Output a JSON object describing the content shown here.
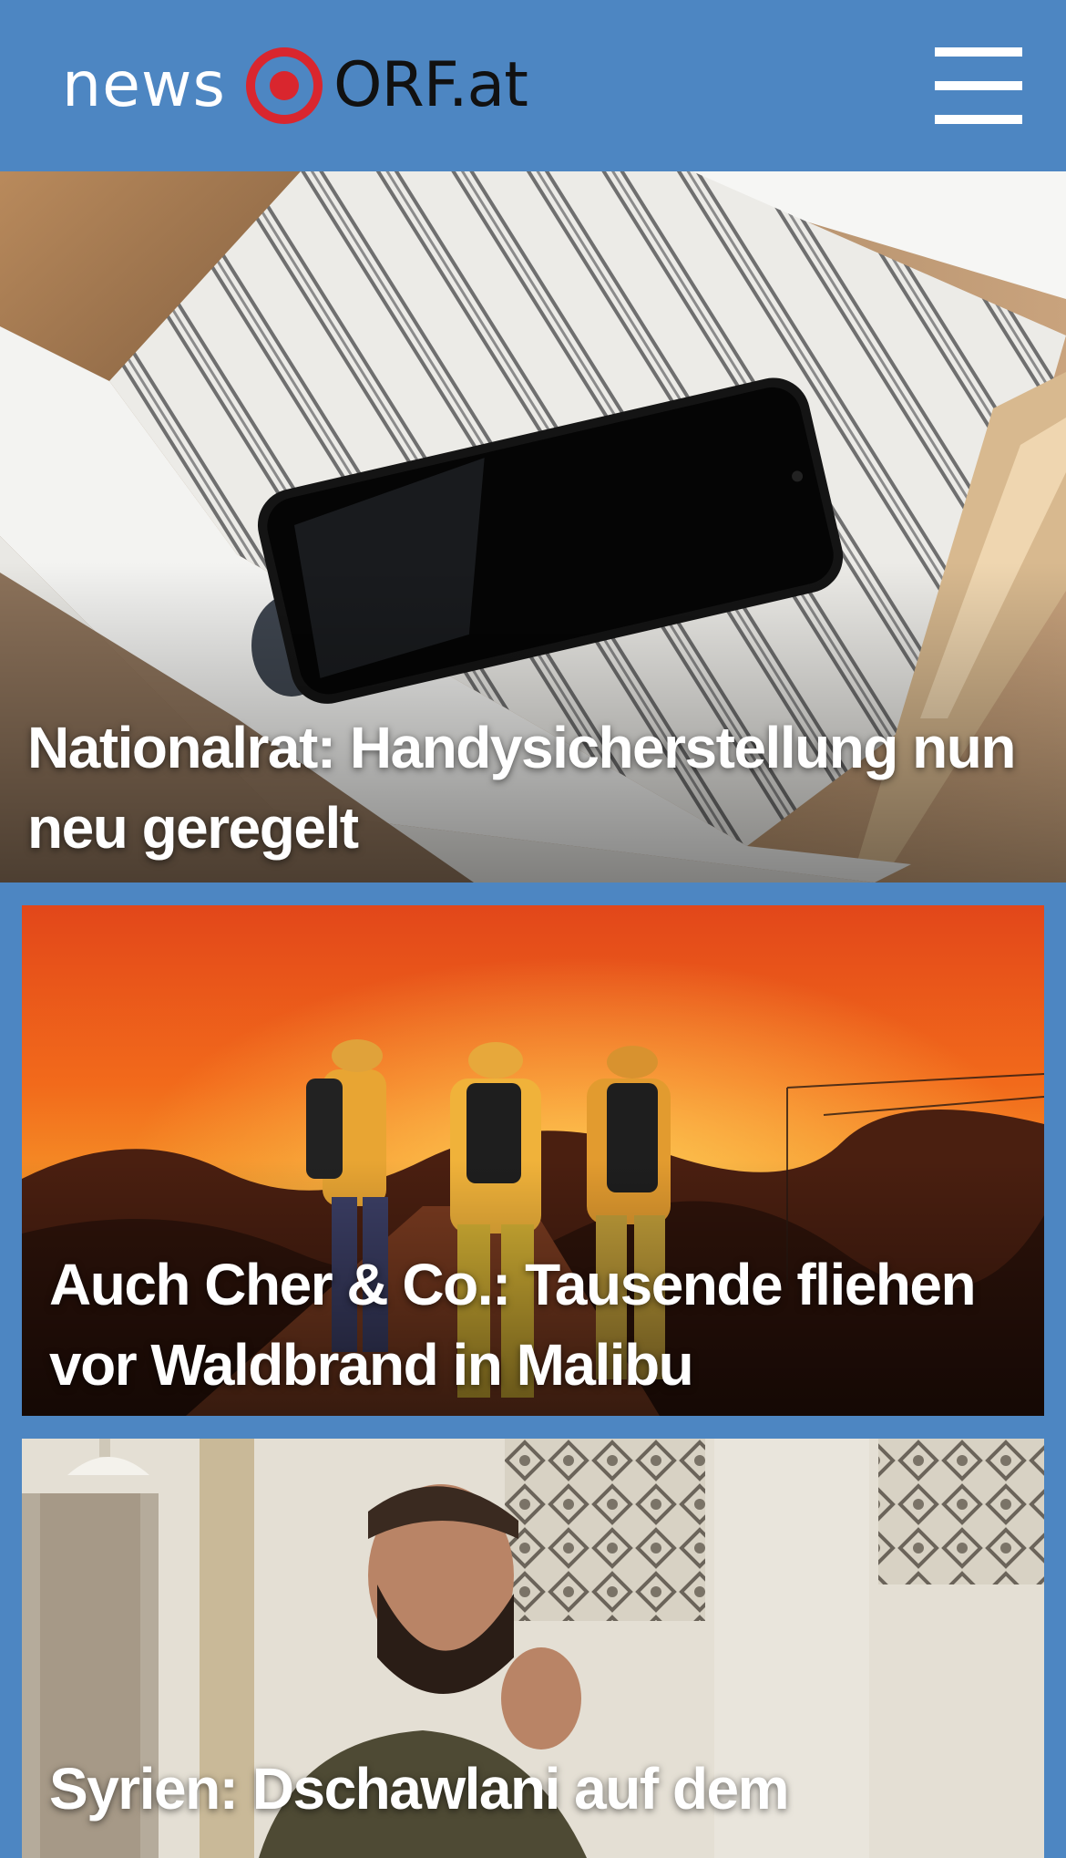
{
  "header": {
    "logo_news": "news",
    "logo_orf": "ORF.at",
    "menu_icon": "hamburger-menu-icon"
  },
  "stories": [
    {
      "headline": "Nationalrat: Handysicherstellung nun neu geregelt",
      "image": "smartphone in open drawer"
    },
    {
      "headline": "Auch Cher & Co.: Tausende fliehen vor Waldbrand in Malibu",
      "image": "firefighters in front of wildfire"
    },
    {
      "headline": "Syrien: Dschawlani auf dem",
      "image": "man speaking in mosque"
    }
  ],
  "colors": {
    "brand_blue": "#4d86c2",
    "logo_red": "#d9262e",
    "headline_text": "#ffffff"
  }
}
